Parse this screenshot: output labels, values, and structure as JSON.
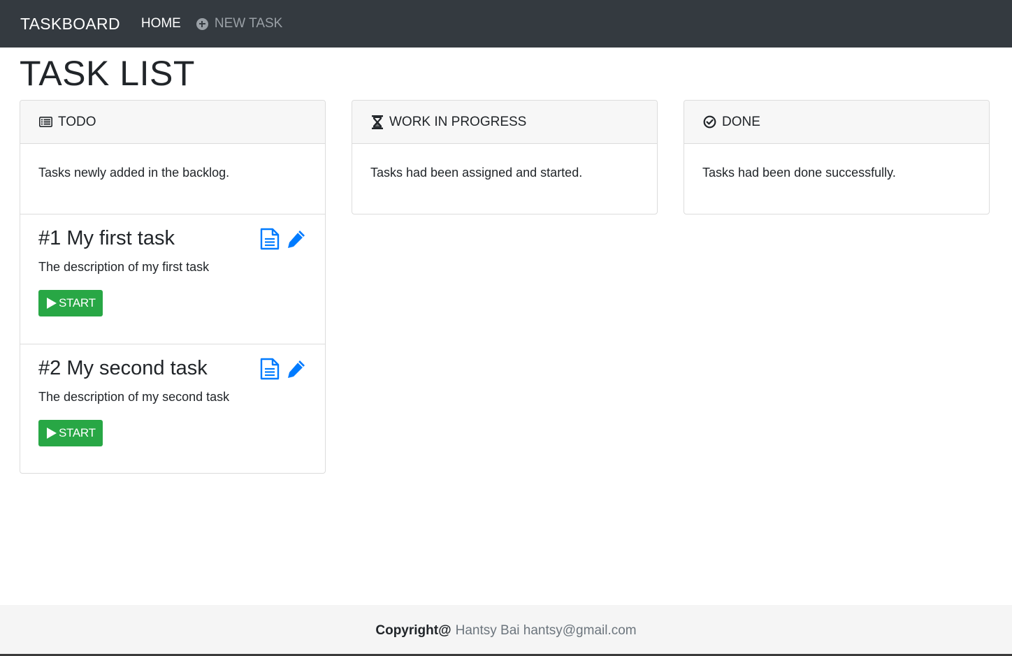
{
  "nav": {
    "brand": "TASKBOARD",
    "home": "HOME",
    "new_task": "NEW TASK"
  },
  "page": {
    "title": "TASK LIST"
  },
  "columns": {
    "todo": {
      "title": "TODO",
      "description": "Tasks newly added in the backlog.",
      "icon": "list-alt-icon"
    },
    "wip": {
      "title": "WORK IN PROGRESS",
      "description": "Tasks had been assigned and started.",
      "icon": "hourglass-icon"
    },
    "done": {
      "title": "DONE",
      "description": "Tasks had been done successfully.",
      "icon": "check-circle-icon"
    }
  },
  "tasks": [
    {
      "title": "#1 My first task",
      "description": "The description of my first task",
      "action": "START"
    },
    {
      "title": "#2 My second task",
      "description": "The description of my second task",
      "action": "START"
    }
  ],
  "footer": {
    "copyright": "Copyright@",
    "author": "Hantsy Bai hantsy@gmail.com"
  },
  "colors": {
    "navbar": "#343a40",
    "primary": "#007bff",
    "success": "#28a745",
    "footer_bg": "#f5f5f5"
  }
}
